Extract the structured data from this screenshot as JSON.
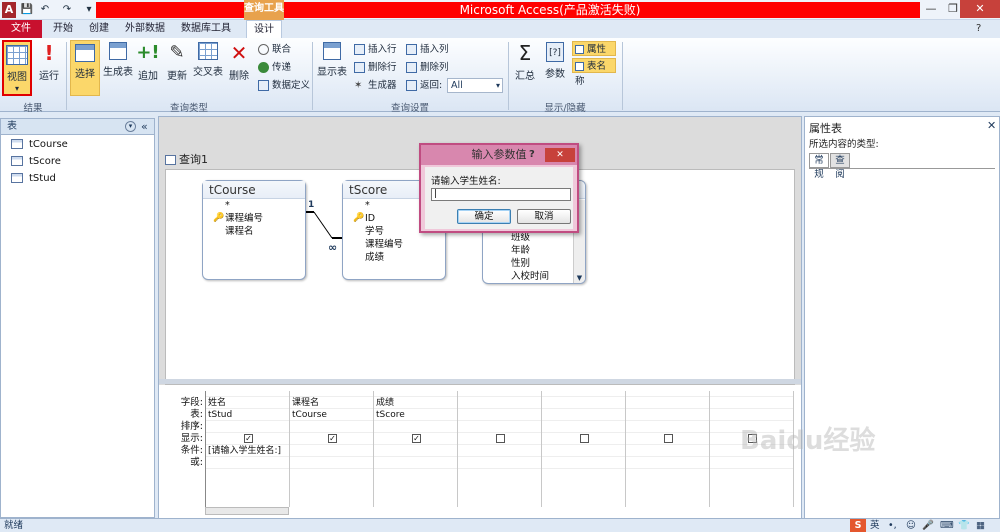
{
  "app": {
    "title": "Microsoft Access(产品激活失败)",
    "context_tab": "查询工具",
    "app_icon": "A"
  },
  "tabs": [
    "文件",
    "开始",
    "创建",
    "外部数据",
    "数据库工具",
    "设计"
  ],
  "ribbon": {
    "results": {
      "label": "结果",
      "view": "视图",
      "run": "运行"
    },
    "query_type": {
      "label": "查询类型",
      "buttons": [
        "选择",
        "生成表",
        "追加",
        "更新",
        "交叉表",
        "删除"
      ],
      "small": [
        "联合",
        "传递",
        "数据定义"
      ]
    },
    "query_setup": {
      "label": "查询设置",
      "show_table": "显示表",
      "small_left": [
        "插入行",
        "删除行",
        "生成器"
      ],
      "small_right": [
        "插入列",
        "删除列"
      ],
      "return_label": "返回:",
      "return_value": "All"
    },
    "show_hide": {
      "label": "显示/隐藏",
      "totals": "汇总",
      "params": "参数",
      "prop_sheet": "属性表",
      "table_names": "表名称"
    }
  },
  "nav": {
    "header": "表",
    "items": [
      "tCourse",
      "tScore",
      "tStud"
    ]
  },
  "query": {
    "tab": "查询1",
    "tables": [
      {
        "name": "tCourse",
        "fields": [
          "*",
          "课程编号",
          "课程名"
        ],
        "key_index": 1
      },
      {
        "name": "tScore",
        "fields": [
          "*",
          "ID",
          "学号",
          "课程编号",
          "成绩"
        ],
        "key_index": 1
      },
      {
        "name": "tStud",
        "fields": [
          "班级",
          "年龄",
          "性别",
          "入校时间"
        ],
        "key_index": -1
      }
    ],
    "relationship": {
      "one": "1",
      "many": "∞"
    },
    "grid": {
      "row_labels": [
        "字段:",
        "表:",
        "排序:",
        "显示:",
        "条件:",
        "或:"
      ],
      "columns": [
        {
          "field": "姓名",
          "table": "tStud",
          "sort": "",
          "show": true,
          "criteria": "[请输入学生姓名:]"
        },
        {
          "field": "课程名",
          "table": "tCourse",
          "sort": "",
          "show": true,
          "criteria": ""
        },
        {
          "field": "成绩",
          "table": "tScore",
          "sort": "",
          "show": true,
          "criteria": ""
        },
        {
          "field": "",
          "table": "",
          "sort": "",
          "show": false,
          "criteria": ""
        },
        {
          "field": "",
          "table": "",
          "sort": "",
          "show": false,
          "criteria": ""
        },
        {
          "field": "",
          "table": "",
          "sort": "",
          "show": false,
          "criteria": ""
        },
        {
          "field": "",
          "table": "",
          "sort": "",
          "show": false,
          "criteria": ""
        }
      ]
    }
  },
  "properties": {
    "title": "属性表",
    "selection_type": "所选内容的类型:",
    "tabs": [
      "常规",
      "查阅"
    ]
  },
  "dialog": {
    "title": "输入参数值",
    "help": "?",
    "prompt": "请输入学生姓名:",
    "value": "",
    "ok": "确定",
    "cancel": "取消"
  },
  "status": {
    "text": "就绪",
    "ime": "英",
    "watermark": "Baidu经验"
  }
}
